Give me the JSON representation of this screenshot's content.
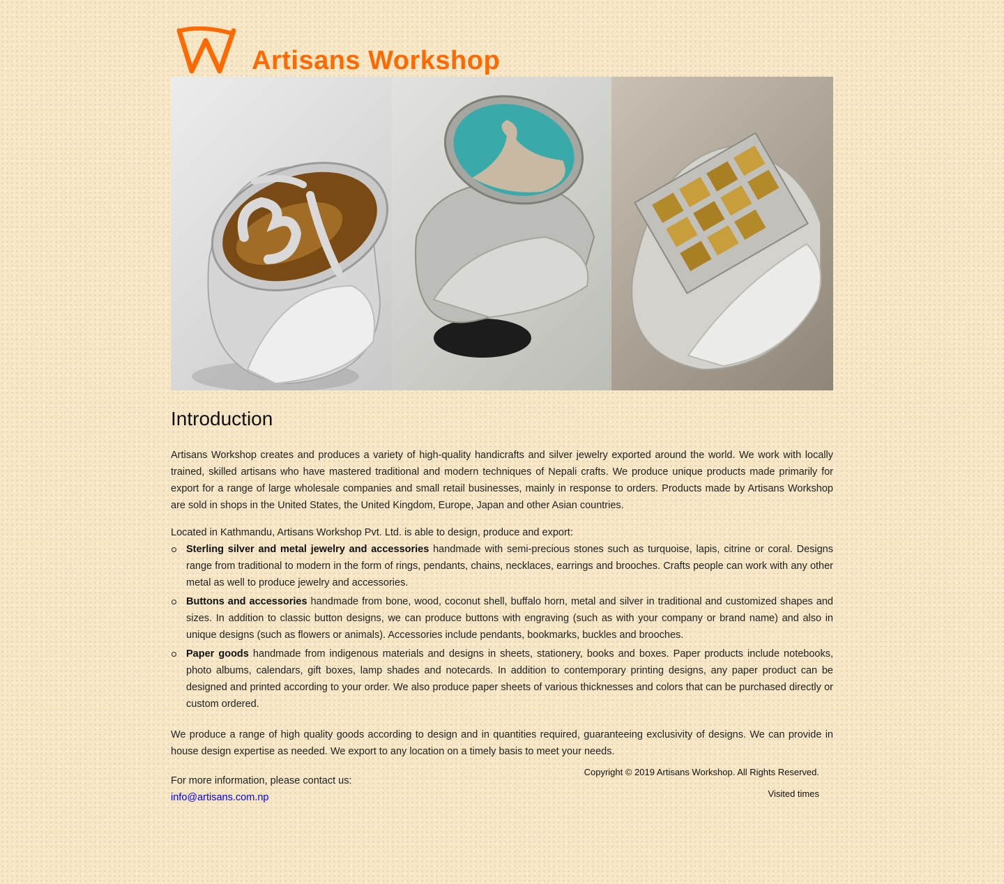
{
  "site": {
    "title": "Artisans Workshop",
    "brand_color": "#ff6a00",
    "logo_icon": "aw-monogram-icon"
  },
  "banner": {
    "images": [
      {
        "name": "om-ring-image",
        "description_icon": "ring-tigers-eye-om-icon"
      },
      {
        "name": "turquoise-ring-image",
        "description_icon": "ring-turquoise-inlay-icon"
      },
      {
        "name": "knot-ring-image",
        "description_icon": "ring-endless-knot-icon"
      }
    ]
  },
  "intro": {
    "heading": "Introduction",
    "paragraph": "Artisans Workshop creates and produces a variety of high-quality handicrafts and silver jewelry exported around the world. We work with locally trained, skilled artisans who have mastered traditional and modern techniques of Nepali crafts. We produce unique products made primarily for export for a range of large wholesale companies and small retail businesses, mainly in response to orders. Products made by Artisans Workshop are sold in shops in the United States, the United Kingdom, Europe, Japan and other Asian countries.",
    "located": "Located in Kathmandu, Artisans Workshop Pvt. Ltd. is able to design, produce and export:"
  },
  "products": [
    {
      "title": "Sterling silver and metal jewelry and accessories",
      "text": " handmade with semi-precious stones such as turquoise, lapis, citrine or coral. Designs range from traditional to modern in the form of rings, pendants, chains, necklaces, earrings and brooches. Crafts people can work with any other metal as well to produce jewelry and accessories."
    },
    {
      "title": "Buttons and accessories",
      "text": " handmade from bone, wood, coconut shell, buffalo horn, metal and silver in traditional and customized shapes and sizes. In addition to classic button designs, we can produce buttons with engraving (such as with your company or brand name) and also in unique designs (such as flowers or animals). Accessories include pendants, bookmarks, buckles and brooches."
    },
    {
      "title": "Paper goods",
      "text": " handmade from indigenous materials and designs in sheets, stationery, books and boxes. Paper products include notebooks, photo albums, calendars, gift boxes, lamp shades and notecards. In addition to contemporary printing designs, any paper product can be designed and printed according to your order. We also produce paper sheets of various thicknesses and colors that can be purchased directly or custom ordered."
    }
  ],
  "produce": "We produce a range of high quality goods according to design and in quantities required, guaranteeing exclusivity of designs. We can provide in house design expertise as needed. We export to any location on a timely basis to meet your needs.",
  "contact": {
    "line": "For more information, please contact us:",
    "email": "info@artisans.com.np",
    "link_color": "#0000ee"
  },
  "footer": {
    "copyright": "Copyright © 2019 Artisans Workshop. All Rights Reserved.",
    "visited": "Visited times"
  }
}
